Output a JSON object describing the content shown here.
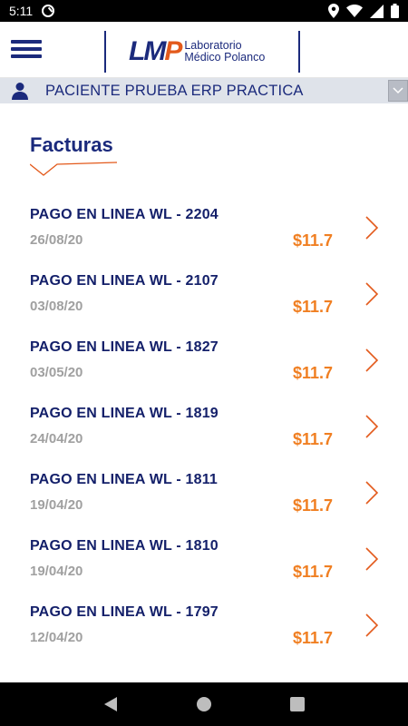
{
  "status_bar": {
    "time": "5:11",
    "icons": [
      "at-sign-icon",
      "location-icon",
      "wifi-icon",
      "signal-icon",
      "battery-icon"
    ]
  },
  "header": {
    "logo_mark": "LMP",
    "logo_line1": "Laboratorio",
    "logo_line2": "Médico Polanco",
    "brand_color": "#1b2a7c",
    "accent_color": "#e35a1c"
  },
  "patient": {
    "name": "PACIENTE PRUEBA ERP PRACTICA"
  },
  "page": {
    "title": "Facturas"
  },
  "invoices": [
    {
      "title": "PAGO EN LINEA WL - 2204",
      "date": "26/08/20",
      "amount": "$11.7"
    },
    {
      "title": "PAGO EN LINEA WL - 2107",
      "date": "03/08/20",
      "amount": "$11.7"
    },
    {
      "title": "PAGO EN LINEA WL - 1827",
      "date": "03/05/20",
      "amount": "$11.7"
    },
    {
      "title": "PAGO EN LINEA WL - 1819",
      "date": "24/04/20",
      "amount": "$11.7"
    },
    {
      "title": "PAGO EN LINEA WL - 1811",
      "date": "19/04/20",
      "amount": "$11.7"
    },
    {
      "title": "PAGO EN LINEA WL - 1810",
      "date": "19/04/20",
      "amount": "$11.7"
    },
    {
      "title": "PAGO EN LINEA WL - 1797",
      "date": "12/04/20",
      "amount": "$11.7"
    }
  ],
  "colors": {
    "amount": "#f07f22",
    "chevron": "#e35a1c",
    "patient_bar": "#dfe3ea"
  }
}
